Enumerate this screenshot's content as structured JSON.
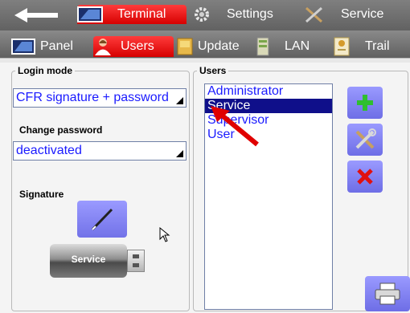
{
  "top_tabs": [
    {
      "label": "Terminal",
      "active": true
    },
    {
      "label": "Settings",
      "active": false
    },
    {
      "label": "Service",
      "active": false
    }
  ],
  "sub_tabs": [
    {
      "label": "Panel",
      "active": false
    },
    {
      "label": "Users",
      "active": true
    },
    {
      "label": "Update",
      "active": false
    },
    {
      "label": "LAN",
      "active": false
    },
    {
      "label": "Trail",
      "active": false
    }
  ],
  "left_panel": {
    "login_mode_legend": "Login mode",
    "login_mode_value": "CFR signature + password",
    "change_password_label": "Change password",
    "change_password_value": "deactivated",
    "signature_label": "Signature",
    "usb_label": "Service"
  },
  "users_panel": {
    "legend": "Users",
    "items": [
      {
        "label": "Administrator",
        "selected": false
      },
      {
        "label": "Service",
        "selected": true
      },
      {
        "label": "Supervisor",
        "selected": false
      },
      {
        "label": "User",
        "selected": false
      }
    ]
  },
  "colors": {
    "active_tab": "#e00000",
    "button": "#8080ff",
    "list_text": "#1a1aff",
    "selection": "#0f0f8a"
  },
  "icons": [
    "back-arrow-icon",
    "terminal-icon",
    "settings-gear-icon",
    "service-tools-icon",
    "panel-icon",
    "users-icon",
    "update-icon",
    "lan-icon",
    "trail-icon",
    "pen-icon",
    "usb-stick-icon",
    "add-icon",
    "edit-tools-icon",
    "delete-icon",
    "printer-icon",
    "cursor-icon",
    "annotation-arrow"
  ]
}
